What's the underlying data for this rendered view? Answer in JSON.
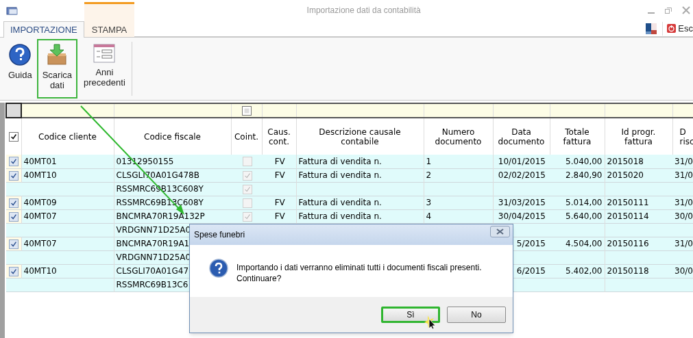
{
  "window": {
    "title": "Importazione dati da contabilità"
  },
  "tabs": [
    {
      "label": "IMPORTAZIONE",
      "selected": true
    },
    {
      "label": "STAMPA",
      "selected": false
    }
  ],
  "exit_button": {
    "label": "Esc"
  },
  "ribbon": [
    {
      "kind": "help",
      "label": "Guida",
      "highlighted": false
    },
    {
      "kind": "download",
      "label": "Scarica\ndati",
      "highlighted": true
    },
    {
      "kind": "list",
      "label": "Anni\nprecedenti",
      "highlighted": false
    }
  ],
  "table": {
    "filter_row": {
      "coint_checked": false
    },
    "select_all_checked": true,
    "columns": [
      "Codice cliente",
      "Codice fiscale",
      "Coint.",
      "Caus.\ncont.",
      "Descrizione causale\ncontabile",
      "Numero\ndocumento",
      "Data\ndocumento",
      "Totale\nfattura",
      "Id progr.\nfattura",
      "D\nrisc"
    ],
    "rows": [
      {
        "kind": "main",
        "checked": true,
        "codice_cliente": "40MT01",
        "codice_fiscale": "01312950155",
        "coint": false,
        "causale": "FV",
        "descrizione": "Fattura di vendita n.",
        "numero": "1",
        "data": "10/01/2015",
        "totale": "5.040,00",
        "id": "2015018",
        "column_11": "31/0"
      },
      {
        "kind": "main",
        "checked": true,
        "codice_cliente": "40MT10",
        "codice_fiscale": "CLSGLI70A01G478B",
        "coint": true,
        "causale": "FV",
        "descrizione": "Fattura di vendita n.",
        "numero": "2",
        "data": "02/02/2015",
        "totale": "2.840,90",
        "id": "2015020",
        "column_11": "31/0"
      },
      {
        "kind": "sub",
        "codice_fiscale": "RSSMRC69B13C608Y",
        "coint": true
      },
      {
        "kind": "main",
        "checked": true,
        "codice_cliente": "40MT09",
        "codice_fiscale": "RSSMRC69B13C608Y",
        "coint": false,
        "causale": "FV",
        "descrizione": "Fattura di vendita n.",
        "numero": "3",
        "data": "31/03/2015",
        "totale": "5.014,00",
        "id": "20150111",
        "column_11": "31/0"
      },
      {
        "kind": "main",
        "checked": true,
        "codice_cliente": "40MT07",
        "codice_fiscale": "BNCMRA70R19A132P",
        "coint": true,
        "causale": "FV",
        "descrizione": "Fattura di vendita n.",
        "numero": "4",
        "data": "30/04/2015",
        "totale": "5.640,00",
        "id": "20150114",
        "column_11": "30/0"
      },
      {
        "kind": "sub",
        "codice_fiscale": "VRDGNN71D25A0"
      },
      {
        "kind": "main",
        "checked": true,
        "codice_cliente": "40MT07",
        "codice_fiscale": "BNCMRA70R19A1",
        "data": "5/2015",
        "totale": "4.504,00",
        "id": "20150116",
        "column_11": "31/0"
      },
      {
        "kind": "sub",
        "codice_fiscale": "VRDGNN71D25A0"
      },
      {
        "kind": "main",
        "checked": true,
        "codice_cliente": "40MT10",
        "codice_fiscale": "CLSGLI70A01G47",
        "data": "6/2015",
        "totale": "5.402,00",
        "id": "20150118",
        "column_11": "30/0"
      },
      {
        "kind": "sub",
        "codice_fiscale": "RSSMRC69B13C6"
      }
    ]
  },
  "dialog": {
    "title": "Spese funebri",
    "message": "Importando i dati verranno eliminati tutti i documenti fiscali presenti.\nContinuare?",
    "buttons": [
      {
        "label": "Sì",
        "highlighted": true
      },
      {
        "label": "No",
        "highlighted": false
      }
    ]
  }
}
